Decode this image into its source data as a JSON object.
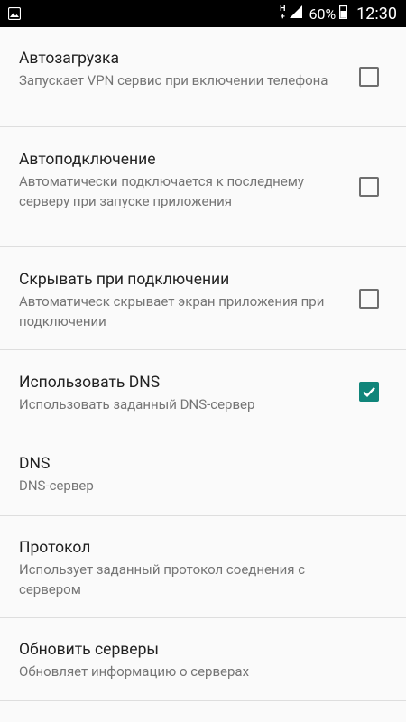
{
  "status_bar": {
    "network": "H+",
    "battery": "60%",
    "time": "12:30"
  },
  "settings": [
    {
      "title": "Автозагрузка",
      "summary": "Запускает VPN сервис при включении телефона",
      "checkbox": true,
      "checked": false
    },
    {
      "title": "Автоподключение",
      "summary": "Автоматически подключается к последнему серверу при запуске приложения",
      "checkbox": true,
      "checked": false
    },
    {
      "title": "Скрывать при подключении",
      "summary": "Автоматическ скрывает экран приложения при подключении",
      "checkbox": true,
      "checked": false
    },
    {
      "title": "Использовать DNS",
      "summary": "Использовать заданный DNS-сервер",
      "checkbox": true,
      "checked": true
    },
    {
      "title": "DNS",
      "summary": "DNS-сервер",
      "checkbox": false
    },
    {
      "title": "Протокол",
      "summary": "Использует заданный протокол соеднения с сервером",
      "checkbox": false
    },
    {
      "title": "Обновить серверы",
      "summary": "Обновляет информацию о серверах",
      "checkbox": false
    }
  ],
  "colors": {
    "accent": "#10857a",
    "title_text": "#212121",
    "summary_text": "#757575",
    "divider": "#dedede",
    "background": "#fafafa"
  }
}
